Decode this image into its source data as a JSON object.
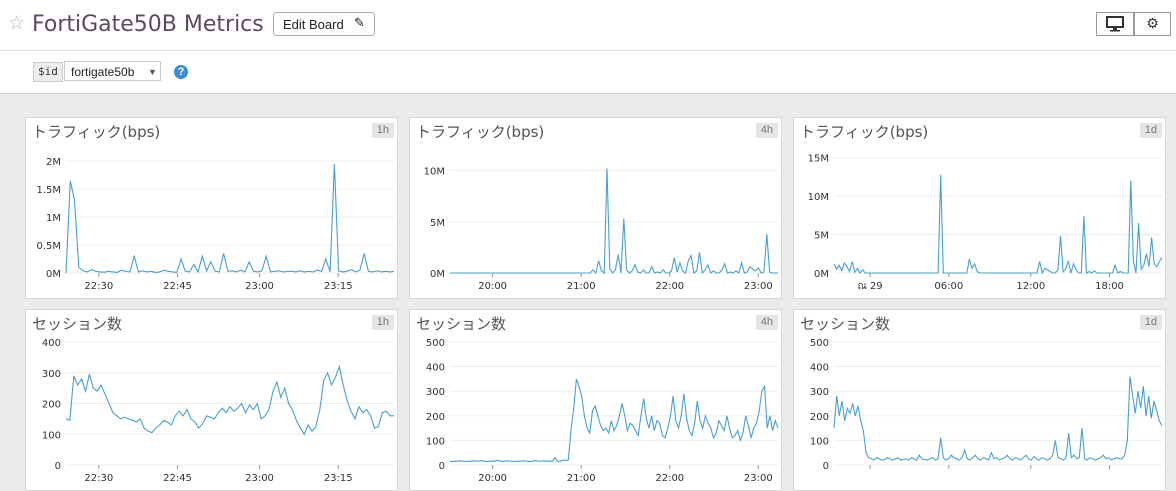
{
  "header": {
    "title": "FortiGate50B Metrics",
    "edit_label": "Edit Board",
    "star_icon": "star-outline-icon",
    "pencil_icon": "pencil-icon",
    "monitor_icon": "monitor-icon",
    "gear_icon": "gear-icon"
  },
  "variables": {
    "name": "$id",
    "value": "fortigate50b",
    "help": "?"
  },
  "panels": [
    {
      "title": "トラフィック(bps)",
      "range": "1h",
      "chart_data": {
        "type": "line",
        "ylim": [
          0,
          2200000
        ],
        "yticks": [
          {
            "v": 0,
            "label": "0M"
          },
          {
            "v": 500000,
            "label": "0.5M"
          },
          {
            "v": 1000000,
            "label": "1M"
          },
          {
            "v": 1500000,
            "label": "1.5M"
          },
          {
            "v": 2000000,
            "label": "2M"
          }
        ],
        "xlabels": [
          "22:30",
          "22:45",
          "23:00",
          "23:15"
        ],
        "xtick_pos": [
          0.1,
          0.34,
          0.59,
          0.83
        ],
        "series": [
          {
            "color": "#4a9fd0",
            "values": [
              0,
              1650000,
              1300000,
              100000,
              40000,
              20000,
              60000,
              30000,
              20000,
              15000,
              30000,
              20000,
              10000,
              50000,
              30000,
              20000,
              300000,
              20000,
              40000,
              20000,
              30000,
              10000,
              20000,
              50000,
              30000,
              20000,
              10000,
              250000,
              30000,
              20000,
              150000,
              20000,
              300000,
              40000,
              200000,
              30000,
              20000,
              350000,
              30000,
              40000,
              20000,
              50000,
              20000,
              200000,
              30000,
              20000,
              40000,
              300000,
              20000,
              30000,
              40000,
              20000,
              30000,
              30000,
              20000,
              40000,
              20000,
              30000,
              20000,
              50000,
              30000,
              250000,
              20000,
              1950000,
              40000,
              20000,
              30000,
              60000,
              20000,
              50000,
              350000,
              30000,
              20000,
              40000,
              20000,
              30000,
              20000,
              30000
            ]
          }
        ]
      }
    },
    {
      "title": "トラフィック(bps)",
      "range": "4h",
      "chart_data": {
        "type": "line",
        "ylim": [
          0,
          12000000
        ],
        "yticks": [
          {
            "v": 0,
            "label": "0M"
          },
          {
            "v": 5000000,
            "label": "5M"
          },
          {
            "v": 10000000,
            "label": "10M"
          }
        ],
        "xlabels": [
          "20:00",
          "21:00",
          "22:00",
          "23:00"
        ],
        "xtick_pos": [
          0.13,
          0.4,
          0.67,
          0.94
        ],
        "series": [
          {
            "color": "#4a9fd0",
            "values": [
              0,
              0,
              0,
              0,
              0,
              0,
              0,
              0,
              0,
              0,
              0,
              0,
              0,
              0,
              0,
              0,
              0,
              0,
              0,
              0,
              0,
              0,
              0,
              0,
              0,
              0,
              0,
              0,
              0,
              0,
              0,
              0,
              0,
              0,
              0,
              0,
              0,
              0,
              0,
              0,
              0,
              0,
              0,
              0,
              0,
              0,
              0,
              0,
              0,
              0,
              0,
              300000,
              0,
              1200000,
              200000,
              0,
              10200000,
              400000,
              0,
              300000,
              1800000,
              0,
              5300000,
              300000,
              0,
              200000,
              800000,
              100000,
              0,
              300000,
              0,
              0,
              600000,
              0,
              100000,
              0,
              300000,
              0,
              0,
              200000,
              1500000,
              100000,
              1000000,
              200000,
              0,
              1200000,
              1700000,
              0,
              200000,
              2000000,
              0,
              300000,
              800000,
              0,
              200000,
              0,
              0,
              300000,
              900000,
              0,
              100000,
              0,
              200000,
              0,
              1000000,
              0,
              100000,
              600000,
              400000,
              200000,
              500000,
              0,
              100000,
              3800000,
              100000,
              0,
              0,
              0
            ]
          }
        ]
      }
    },
    {
      "title": "トラフィック(bps)",
      "range": "1d",
      "chart_data": {
        "type": "line",
        "ylim": [
          0,
          16000000
        ],
        "yticks": [
          {
            "v": 0,
            "label": "0M"
          },
          {
            "v": 5000000,
            "label": "5M"
          },
          {
            "v": 10000000,
            "label": "10M"
          },
          {
            "v": 15000000,
            "label": "15M"
          }
        ],
        "xlabels": [
          "ณ 29",
          "06:00",
          "12:00",
          "18:00"
        ],
        "xtick_pos": [
          0.11,
          0.35,
          0.6,
          0.84
        ],
        "series": [
          {
            "color": "#4a9fd0",
            "values": [
              1200000,
              500000,
              1000000,
              300000,
              1300000,
              800000,
              200000,
              1500000,
              100000,
              600000,
              0,
              400000,
              0,
              0,
              0,
              0,
              0,
              0,
              0,
              0,
              0,
              0,
              0,
              0,
              0,
              0,
              0,
              0,
              0,
              0,
              0,
              0,
              0,
              0,
              0,
              0,
              0,
              0,
              0,
              0,
              0,
              12800000,
              0,
              0,
              0,
              0,
              0,
              0,
              0,
              0,
              0,
              0,
              1800000,
              600000,
              1200000,
              200000,
              0,
              0,
              0,
              0,
              0,
              0,
              0,
              0,
              0,
              0,
              0,
              0,
              0,
              0,
              0,
              0,
              0,
              0,
              0,
              0,
              0,
              0,
              0,
              1500000,
              0,
              600000,
              400000,
              200000,
              0,
              0,
              400000,
              4800000,
              200000,
              500000,
              1600000,
              0,
              1200000,
              400000,
              0,
              0,
              7400000,
              0,
              200000,
              0,
              300000,
              0,
              0,
              0,
              0,
              0,
              0,
              0,
              1000000,
              0,
              200000,
              0,
              0,
              0,
              12000000,
              1500000,
              0,
              6500000,
              500000,
              1000000,
              2500000,
              800000,
              4600000,
              1200000,
              800000,
              1500000,
              2000000
            ]
          }
        ]
      }
    },
    {
      "title": "セッション数",
      "range": "1h",
      "chart_data": {
        "type": "line",
        "ylim": [
          0,
          400
        ],
        "yticks": [
          {
            "v": 0,
            "label": "0"
          },
          {
            "v": 100,
            "label": "100"
          },
          {
            "v": 200,
            "label": "200"
          },
          {
            "v": 300,
            "label": "300"
          },
          {
            "v": 400,
            "label": "400"
          }
        ],
        "xlabels": [
          "22:30",
          "22:45",
          "23:00",
          "23:15"
        ],
        "xtick_pos": [
          0.1,
          0.34,
          0.59,
          0.83
        ],
        "series": [
          {
            "color": "#4a9fd0",
            "values": [
              150,
              145,
              290,
              260,
              280,
              240,
              295,
              250,
              240,
              260,
              230,
              200,
              170,
              160,
              150,
              155,
              150,
              145,
              140,
              150,
              120,
              110,
              105,
              120,
              130,
              145,
              140,
              130,
              160,
              175,
              160,
              180,
              150,
              140,
              120,
              135,
              160,
              155,
              150,
              170,
              185,
              170,
              190,
              175,
              185,
              200,
              170,
              195,
              180,
              200,
              150,
              160,
              180,
              240,
              270,
              220,
              250,
              200,
              180,
              145,
              120,
              100,
              130,
              110,
              125,
              180,
              275,
              300,
              260,
              285,
              320,
              260,
              210,
              175,
              150,
              190,
              170,
              180,
              160,
              120,
              125,
              170,
              175,
              160,
              160
            ]
          }
        ]
      }
    },
    {
      "title": "セッション数",
      "range": "4h",
      "chart_data": {
        "type": "line",
        "ylim": [
          0,
          500
        ],
        "yticks": [
          {
            "v": 0,
            "label": "0"
          },
          {
            "v": 100,
            "label": "100"
          },
          {
            "v": 200,
            "label": "200"
          },
          {
            "v": 300,
            "label": "300"
          },
          {
            "v": 400,
            "label": "400"
          },
          {
            "v": 500,
            "label": "500"
          }
        ],
        "xlabels": [
          "20:00",
          "21:00",
          "22:00",
          "23:00"
        ],
        "xtick_pos": [
          0.13,
          0.4,
          0.67,
          0.94
        ],
        "series": [
          {
            "color": "#4a9fd0",
            "values": [
              15,
              14,
              16,
              15,
              17,
              15,
              14,
              16,
              15,
              18,
              15,
              16,
              17,
              15,
              14,
              16,
              15,
              17,
              18,
              16,
              15,
              17,
              16,
              15,
              14,
              16,
              15,
              17,
              16,
              15,
              14,
              16,
              18,
              15,
              16,
              17,
              15,
              16,
              15,
              30,
              15,
              15,
              20,
              18,
              20,
              140,
              230,
              350,
              320,
              280,
              200,
              150,
              130,
              220,
              240,
              200,
              160,
              140,
              150,
              130,
              180,
              140,
              160,
              200,
              250,
              200,
              140,
              170,
              160,
              140,
              120,
              200,
              270,
              190,
              150,
              200,
              140,
              180,
              170,
              120,
              110,
              150,
              200,
              280,
              180,
              150,
              200,
              290,
              190,
              140,
              120,
              170,
              260,
              180,
              150,
              200,
              170,
              150,
              110,
              130,
              180,
              160,
              140,
              200,
              150,
              110,
              120,
              140,
              100,
              130,
              200,
              160,
              110,
              150,
              170,
              220,
              300,
              320,
              150,
              200,
              140,
              180,
              150
            ]
          }
        ]
      }
    },
    {
      "title": "セッション数",
      "range": "1d",
      "chart_data": {
        "type": "line",
        "ylim": [
          0,
          500
        ],
        "yticks": [
          {
            "v": 0,
            "label": "0"
          },
          {
            "v": 100,
            "label": "100"
          },
          {
            "v": 200,
            "label": "200"
          },
          {
            "v": 300,
            "label": "300"
          },
          {
            "v": 400,
            "label": "400"
          },
          {
            "v": 500,
            "label": "500"
          }
        ],
        "xlabels": [
          "",
          "",
          "",
          ""
        ],
        "xtick_pos": [
          0.11,
          0.35,
          0.6,
          0.84
        ],
        "series": [
          {
            "color": "#4a9fd0",
            "values": [
              150,
              280,
              200,
              260,
              180,
              230,
              210,
              250,
              200,
              240,
              180,
              140,
              50,
              30,
              25,
              20,
              30,
              25,
              20,
              22,
              30,
              25,
              20,
              25,
              30,
              20,
              22,
              25,
              20,
              30,
              25,
              20,
              40,
              25,
              22,
              20,
              25,
              30,
              20,
              25,
              110,
              30,
              20,
              25,
              40,
              30,
              25,
              20,
              30,
              60,
              25,
              20,
              30,
              40,
              25,
              20,
              30,
              25,
              20,
              50,
              25,
              30,
              20,
              25,
              30,
              40,
              25,
              20,
              30,
              25,
              20,
              30,
              40,
              25,
              20,
              35,
              25,
              20,
              30,
              25,
              20,
              25,
              40,
              100,
              30,
              25,
              20,
              30,
              130,
              30,
              40,
              25,
              30,
              150,
              25,
              20,
              30,
              25,
              20,
              25,
              30,
              40,
              25,
              30,
              20,
              25,
              30,
              25,
              25,
              40,
              100,
              360,
              280,
              210,
              300,
              230,
              320,
              200,
              280,
              190,
              260,
              220,
              180,
              160
            ]
          }
        ]
      }
    }
  ]
}
